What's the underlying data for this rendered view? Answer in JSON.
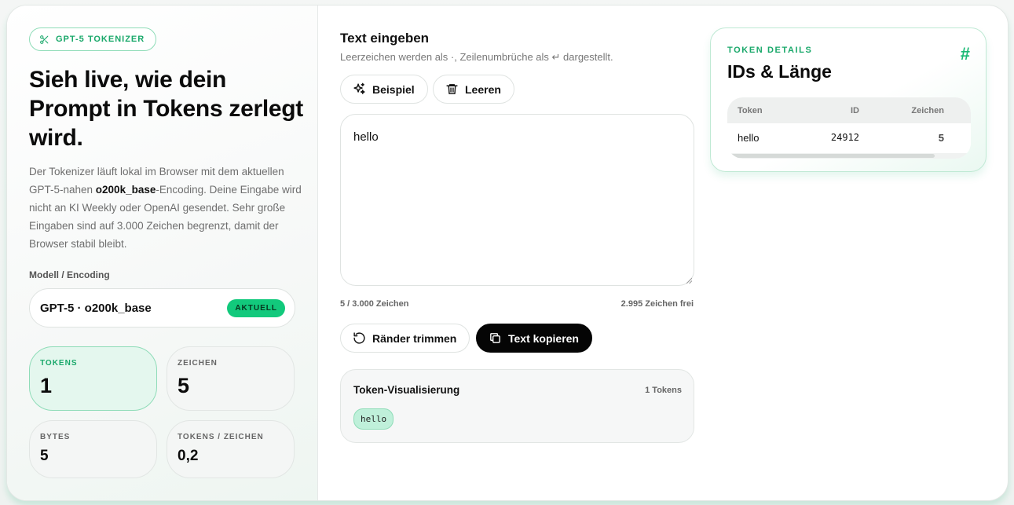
{
  "left": {
    "badge": "GPT-5 TOKENIZER",
    "title": "Sieh live, wie dein Prompt in Tokens zerlegt wird.",
    "desc_part1": "Der Tokenizer läuft lokal im Browser mit dem aktuellen GPT-5-nahen ",
    "desc_bold": "o200k_base",
    "desc_part2": "-Encoding. Deine Eingabe wird nicht an KI Weekly oder OpenAI gesendet. Sehr große Eingaben sind auf 3.000 Zeichen begrenzt, damit der Browser stabil bleibt.",
    "model_label": "Modell / Encoding",
    "model_name": "GPT-5 · o200k_base",
    "model_badge": "AKTUELL",
    "stats": [
      {
        "label": "TOKENS",
        "value": "1"
      },
      {
        "label": "ZEICHEN",
        "value": "5"
      },
      {
        "label": "BYTES",
        "value": "5"
      },
      {
        "label": "TOKENS / ZEICHEN",
        "value": "0,2"
      }
    ]
  },
  "mid": {
    "title": "Text eingeben",
    "subtitle": "Leerzeichen werden als ·, Zeilenumbrüche als ↵ dargestellt.",
    "btn_example": "Beispiel",
    "btn_clear": "Leeren",
    "input_value": "hello",
    "count_used": "5 / 3.000 Zeichen",
    "count_free": "2.995 Zeichen frei",
    "btn_trim": "Ränder trimmen",
    "btn_copy": "Text kopieren",
    "viz_title": "Token-Visualisierung",
    "viz_count": "1 Tokens",
    "tokens": [
      "hello"
    ]
  },
  "card": {
    "kicker": "TOKEN DETAILS",
    "title": "IDs & Länge",
    "icon": "#",
    "columns": [
      "Token",
      "ID",
      "Zeichen"
    ],
    "rows": [
      {
        "token": "hello",
        "id": "24912",
        "chars": "5"
      }
    ]
  },
  "colors": {
    "accent": "#12c97c",
    "accent_text": "#19a86a",
    "dark_button": "#050505"
  }
}
